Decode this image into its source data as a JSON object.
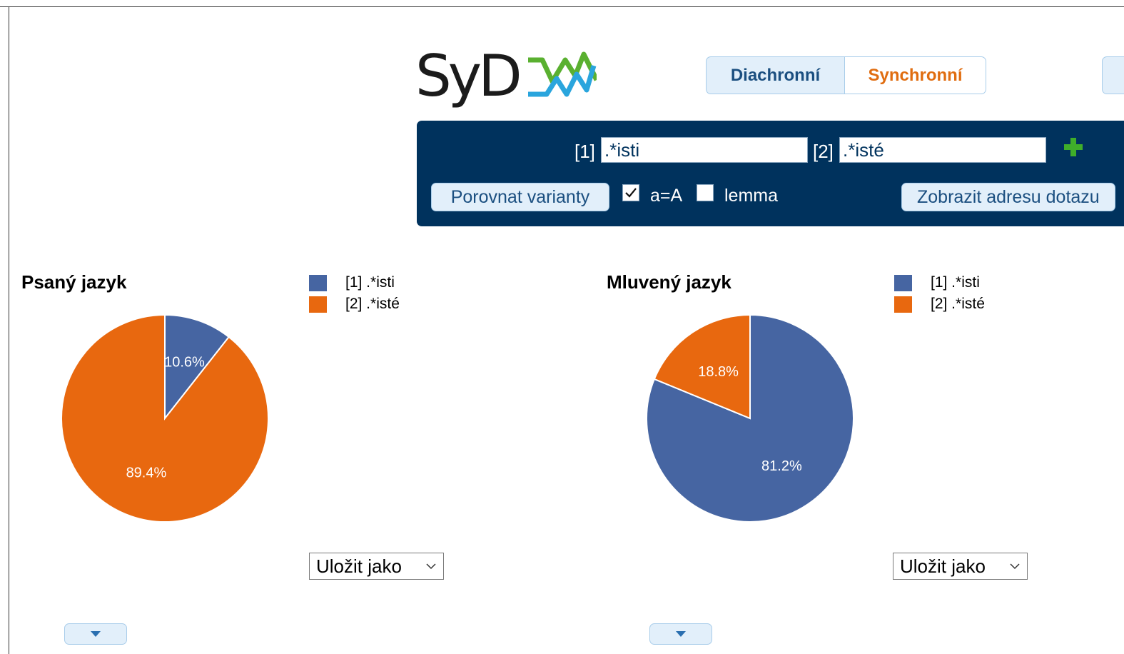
{
  "logo": {
    "text": "SyD"
  },
  "mode_tabs": [
    {
      "label": "Diachronní",
      "active": false
    },
    {
      "label": "Synchronní",
      "active": true
    }
  ],
  "query": {
    "variant1_label": "[1]",
    "variant1_value": ".*isti",
    "variant2_label": "[2]",
    "variant2_value": ".*isté",
    "compare_button": "Porovnat varianty",
    "case_label": "a=A",
    "case_checked": true,
    "lemma_label": "lemma",
    "lemma_checked": false,
    "show_query_url_button": "Zobrazit adresu dotazu"
  },
  "colors": {
    "series1": "#4665a2",
    "series2": "#e8680f",
    "panel": "#00325d",
    "accent": "#e06d10"
  },
  "charts": {
    "written": {
      "save_label": "Uložit jako"
    },
    "spoken": {
      "save_label": "Uložit jako"
    }
  },
  "chart_data": [
    {
      "type": "pie",
      "title": "Psaný jazyk",
      "legend": [
        "[1] .*isti",
        "[2] .*isté"
      ],
      "values": [
        10.6,
        89.4
      ],
      "labels": [
        "10.6%",
        "89.4%"
      ],
      "legend_placement": "right"
    },
    {
      "type": "pie",
      "title": "Mluvený jazyk",
      "legend": [
        "[1] .*isti",
        "[2] .*isté"
      ],
      "values": [
        81.2,
        18.8
      ],
      "labels": [
        "81.2%",
        "18.8%"
      ],
      "legend_placement": "right"
    }
  ]
}
